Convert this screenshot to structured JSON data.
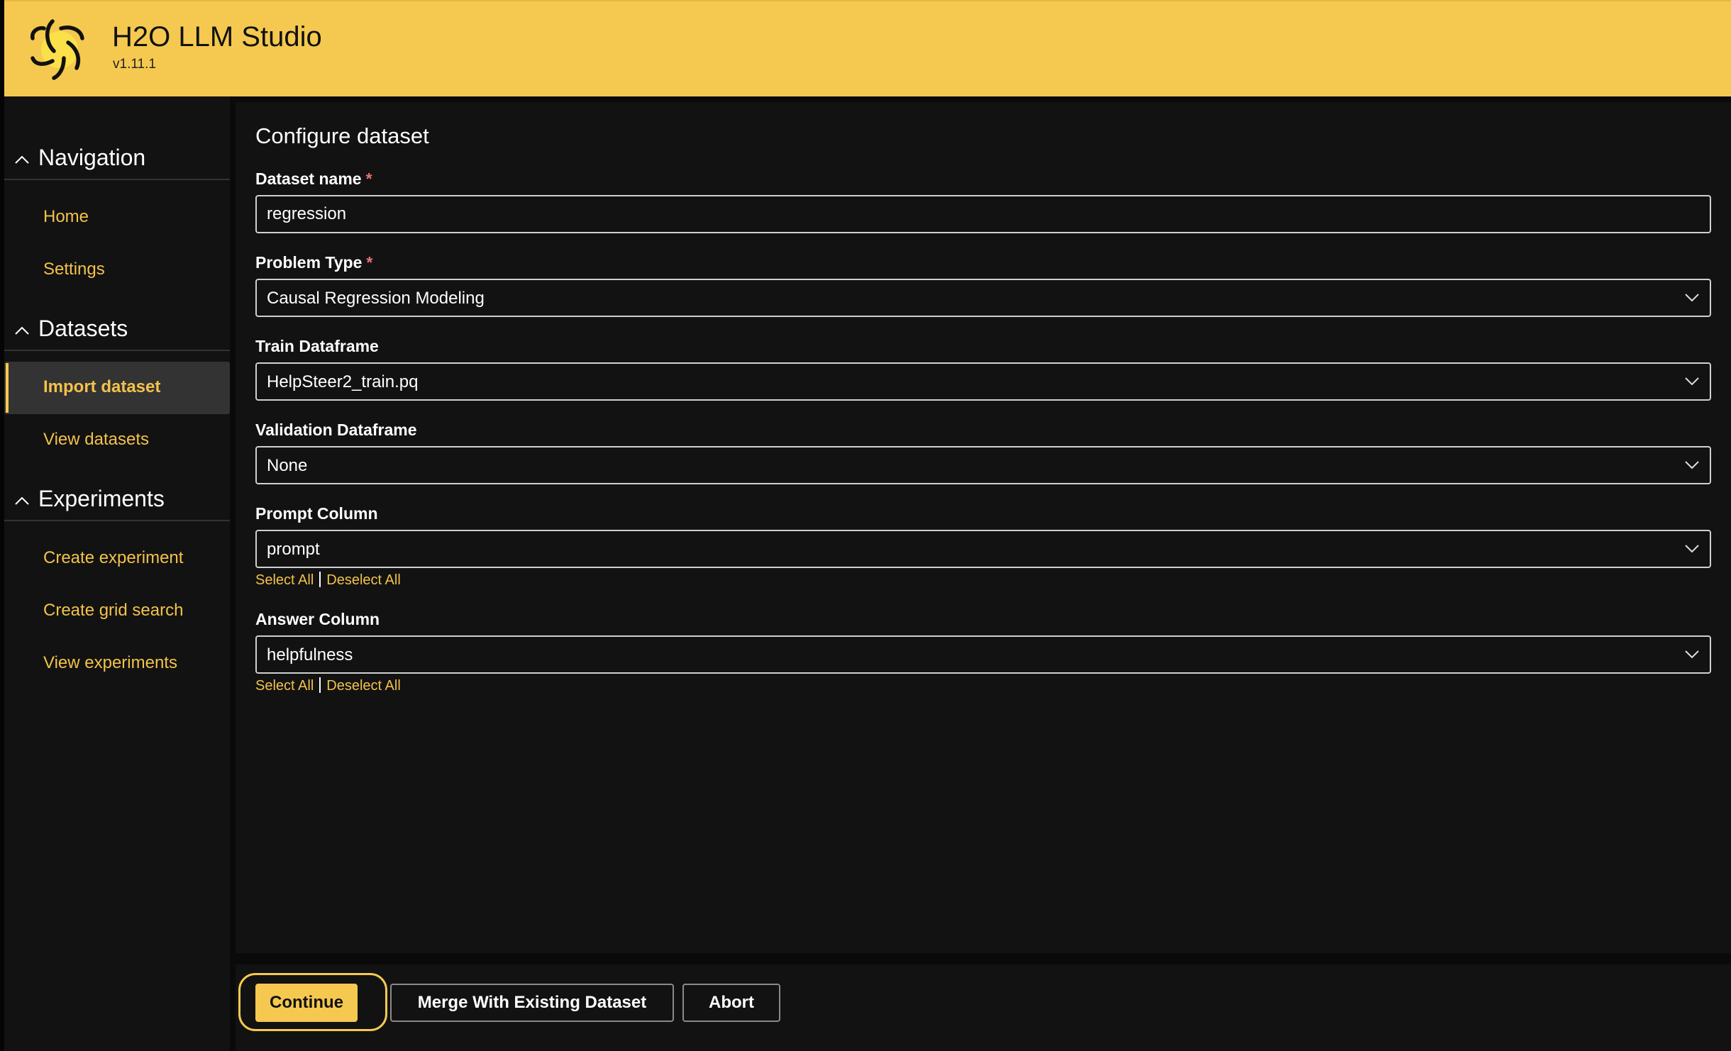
{
  "header": {
    "app_title": "H2O LLM Studio",
    "version": "v1.11.1",
    "logo_icon": "h2o-star-logo"
  },
  "sidebar": {
    "sections": [
      {
        "title": "Navigation",
        "expanded": true,
        "items": [
          {
            "label": "Home",
            "active": false
          },
          {
            "label": "Settings",
            "active": false
          }
        ]
      },
      {
        "title": "Datasets",
        "expanded": true,
        "items": [
          {
            "label": "Import dataset",
            "active": true
          },
          {
            "label": "View datasets",
            "active": false
          }
        ]
      },
      {
        "title": "Experiments",
        "expanded": true,
        "items": [
          {
            "label": "Create experiment",
            "active": false
          },
          {
            "label": "Create grid search",
            "active": false
          },
          {
            "label": "View experiments",
            "active": false
          }
        ]
      }
    ]
  },
  "main": {
    "title": "Configure dataset",
    "fields": [
      {
        "label": "Dataset name",
        "required": "*",
        "type": "text",
        "value": "regression"
      },
      {
        "label": "Problem Type",
        "required": "*",
        "type": "dropdown",
        "value": "Causal Regression Modeling"
      },
      {
        "label": "Train Dataframe",
        "type": "dropdown",
        "value": "HelpSteer2_train.pq"
      },
      {
        "label": "Validation Dataframe",
        "type": "dropdown",
        "value": "None"
      },
      {
        "label": "Prompt Column",
        "type": "dropdown",
        "value": "prompt",
        "select_all": "Select All",
        "deselect_all": "Deselect All"
      },
      {
        "label": "Answer Column",
        "type": "dropdown",
        "value": "helpfulness",
        "select_all": "Select All",
        "deselect_all": "Deselect All"
      }
    ]
  },
  "footer": {
    "continue_label": "Continue",
    "merge_label": "Merge With Existing Dataset",
    "abort_label": "Abort"
  },
  "colors": {
    "accent": "#f5c94f",
    "link": "#f3c24a",
    "background": "#121212",
    "required": "#e57373"
  }
}
